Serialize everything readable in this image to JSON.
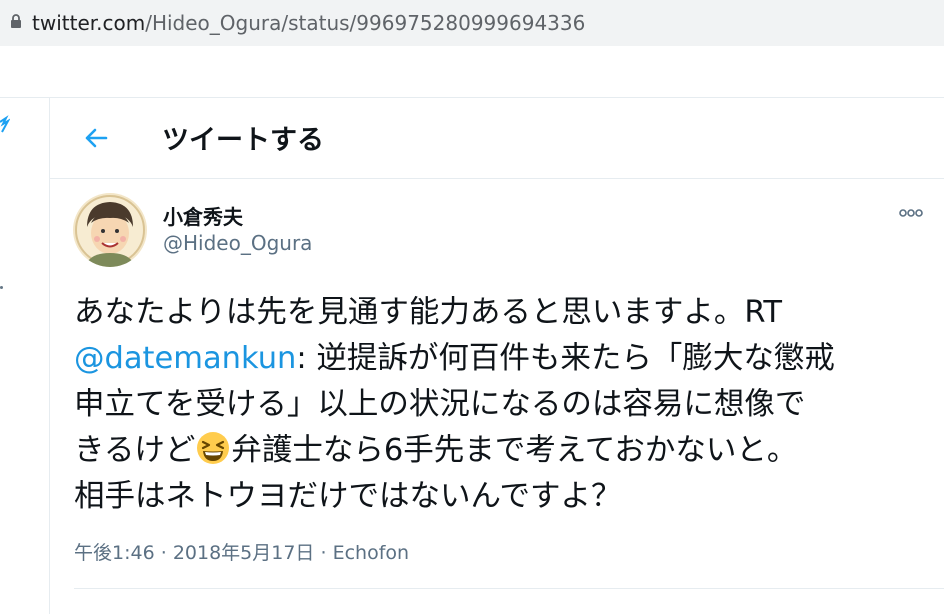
{
  "browser": {
    "url_domain": "twitter.com",
    "url_path": "/Hideo_Ogura/status/996975280999694336"
  },
  "header": {
    "title": "ツイートする",
    "back_icon": "arrow-left-icon",
    "accent_color": "#1da1f2"
  },
  "tweet": {
    "author": {
      "display_name": "小倉秀夫",
      "handle": "@Hideo_Ogura"
    },
    "text_lines": [
      "あなたよりは先を見通す能力あると思いますよ。RT",
      "@datemankun",
      ":  逆提訴が何百件も来たら「膨大な懲戒",
      "申立てを受ける」以上の状況になるのは容易に想像で",
      "きるけど",
      "弁護士なら6手先まで考えておかないと。",
      "相手はネトウヨだけではないんですよ？"
    ],
    "emoji": "grinning-squinting-face-emoji",
    "time": "午後1:46",
    "separator": "·",
    "date": "2018年5月17日",
    "source": "Echofon",
    "more_icon": "more-options-icon"
  },
  "colors": {
    "mention": "#1b95e0",
    "secondary_text": "#5b7083",
    "divider": "#e6ecf0"
  }
}
